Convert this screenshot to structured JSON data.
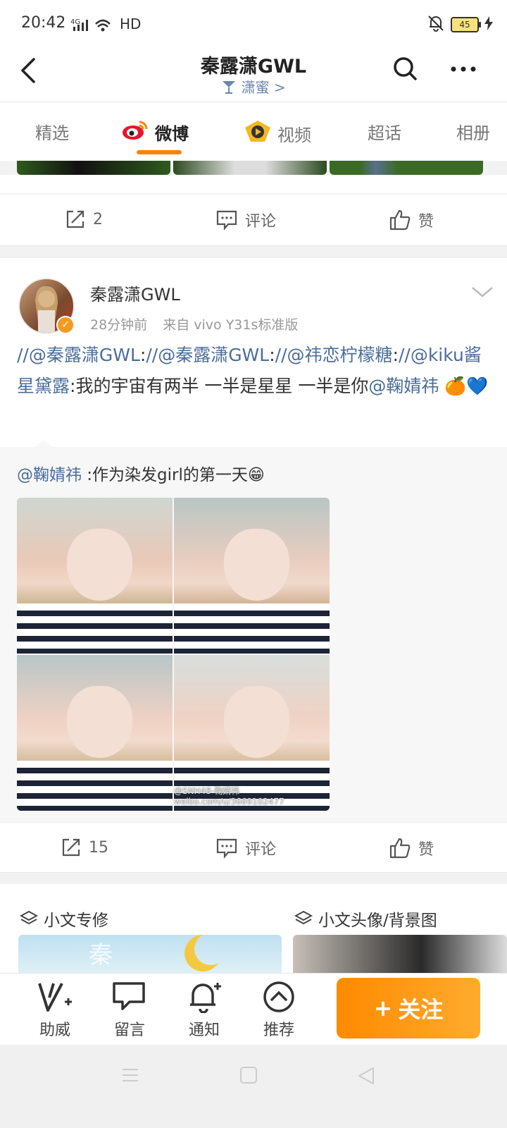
{
  "status_bar": {
    "time": "20:42",
    "network": "4G",
    "hd": "HD",
    "battery": "45"
  },
  "header": {
    "title": "秦露潇GWL",
    "subtitle": "潇蜜 >"
  },
  "tabs": [
    {
      "label": "精选"
    },
    {
      "label": "微博"
    },
    {
      "label": "视频"
    },
    {
      "label": "超话"
    },
    {
      "label": "相册"
    }
  ],
  "prev_post": {
    "repost_count": "2",
    "comment_label": "评论",
    "like_label": "赞"
  },
  "post": {
    "author": "秦露潇GWL",
    "time": "28分钟前",
    "source": "来自 vivo Y31s标准版",
    "text_parts": [
      "//",
      "@秦露潇GWL",
      ":",
      "//",
      "@秦露潇GWL",
      ":",
      "//",
      "@祎恋柠檬糖",
      ":",
      "//",
      "@kiku酱星黛露",
      ":我的宇宙有两半 一半是星星 一半是你",
      "@鞠婧祎",
      " 🍊💙"
    ],
    "repost": {
      "mention": "@鞠婧祎",
      "text": " :作为染发girl的第一天😁",
      "watermark": "@SNH48-鞠婧祎 weibo.com/u/3669102477"
    },
    "repost_count": "15",
    "comment_label": "评论",
    "like_label": "赞"
  },
  "cards": [
    {
      "title": "小文专修"
    },
    {
      "title": "小文头像/背景图"
    }
  ],
  "bottom_bar": {
    "items": [
      {
        "label": "助威"
      },
      {
        "label": "留言"
      },
      {
        "label": "通知"
      },
      {
        "label": "推荐"
      }
    ],
    "follow_label": "关注"
  },
  "colors": {
    "accent": "#ff8200",
    "link": "#4a6d9a",
    "follow_btn": "#ff8a00"
  }
}
